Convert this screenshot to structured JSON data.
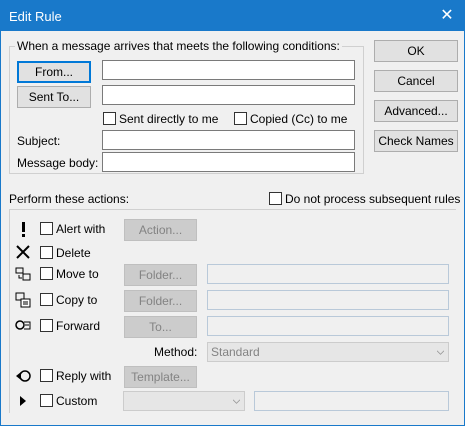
{
  "window": {
    "title": "Edit Rule"
  },
  "conditions": {
    "legend": "When a message arrives that meets the following conditions:",
    "from_label": "From...",
    "sent_to_label": "Sent To...",
    "from_value": "",
    "sent_to_value": "",
    "sent_directly_label": "Sent directly to me",
    "copied_label": "Copied (Cc) to me",
    "subject_label": "Subject:",
    "body_label": "Message body:",
    "subject_value": "",
    "body_value": ""
  },
  "buttons": {
    "ok": "OK",
    "cancel": "Cancel",
    "advanced": "Advanced...",
    "check_names": "Check Names"
  },
  "actions": {
    "legend": "Perform these actions:",
    "do_not_process": "Do not process subsequent rules",
    "rows": [
      {
        "icon": "exclamation-icon",
        "label": "Alert with",
        "button": "Action..."
      },
      {
        "icon": "delete-x-icon",
        "label": "Delete"
      },
      {
        "icon": "move-to-icon",
        "label": "Move to",
        "button": "Folder..."
      },
      {
        "icon": "copy-to-icon",
        "label": "Copy to",
        "button": "Folder..."
      },
      {
        "icon": "forward-icon",
        "label": "Forward",
        "button": "To..."
      },
      {
        "icon": "reply-icon",
        "label": "Reply with",
        "button": "Template..."
      },
      {
        "icon": "play-arrow-icon",
        "label": "Custom"
      }
    ],
    "method_label": "Method:",
    "method_value": "Standard"
  },
  "colors": {
    "titlebar": "#1979ca",
    "dialog_bg": "#f0f0f0"
  }
}
